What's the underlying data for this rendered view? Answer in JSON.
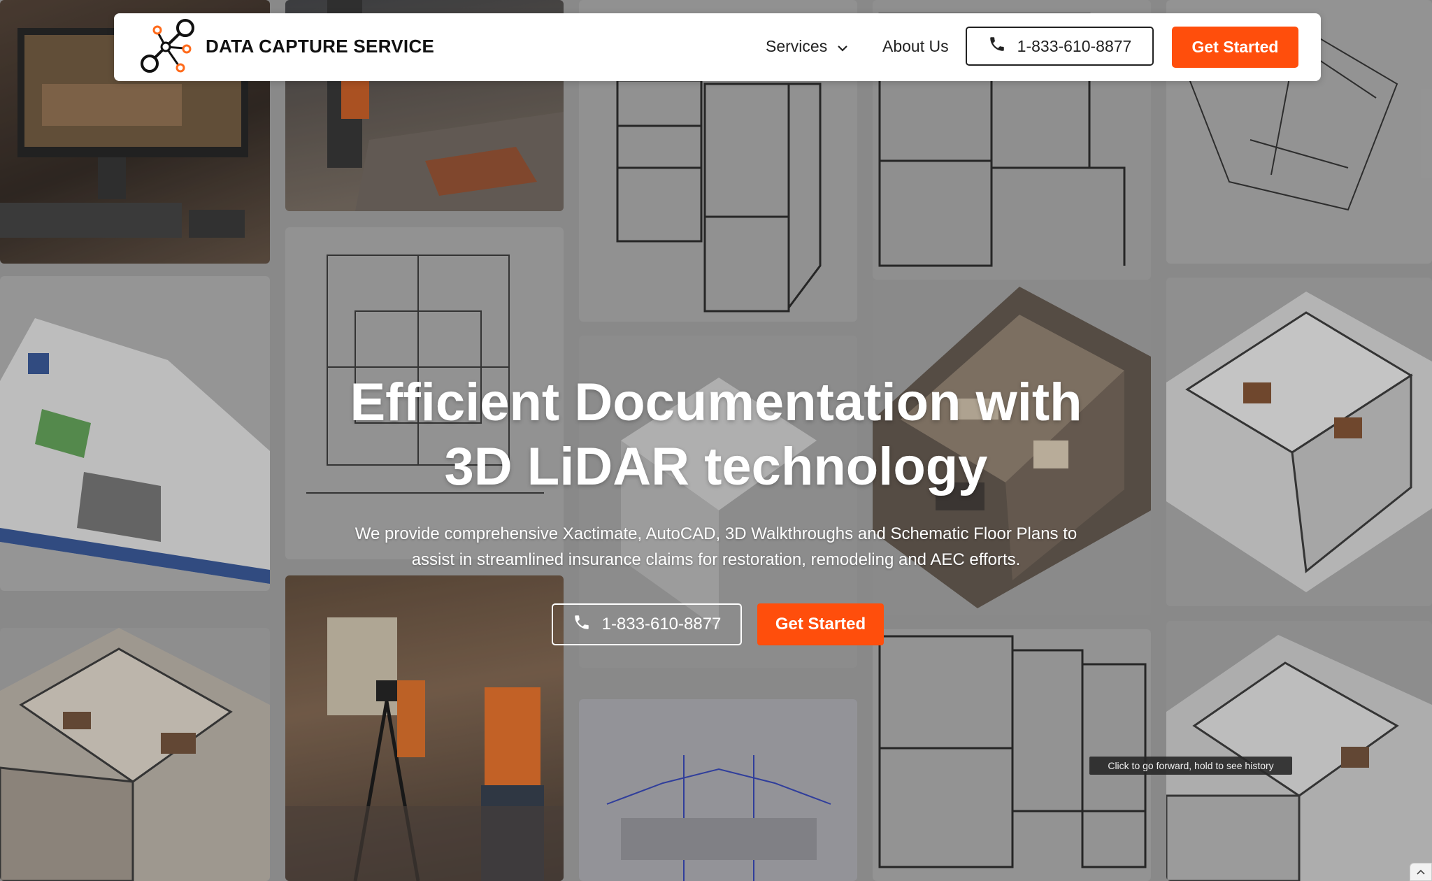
{
  "brand": {
    "name": "DATA CAPTURE SERVICE",
    "accent_color": "#ff4e0c"
  },
  "nav": {
    "services_label": "Services",
    "about_label": "About Us",
    "phone_label": "1-833-610-8877",
    "cta_label": "Get Started"
  },
  "hero": {
    "title_line1": "Efficient Documentation with",
    "title_line2": "3D LiDAR technology",
    "subtitle_line1": "We provide comprehensive Xactimate, AutoCAD, 3D Walkthroughs and Schematic Floor Plans to",
    "subtitle_line2": "assist in streamlined insurance claims for restoration, remodeling and AEC efforts.",
    "phone_label": "1-833-610-8877",
    "cta_label": "Get Started"
  },
  "browser": {
    "tooltip": "Click to go forward, hold to see history"
  },
  "icons": {
    "logo": "network-nodes-logo",
    "services_chevron": "chevron-down-icon",
    "phone": "phone-icon"
  }
}
